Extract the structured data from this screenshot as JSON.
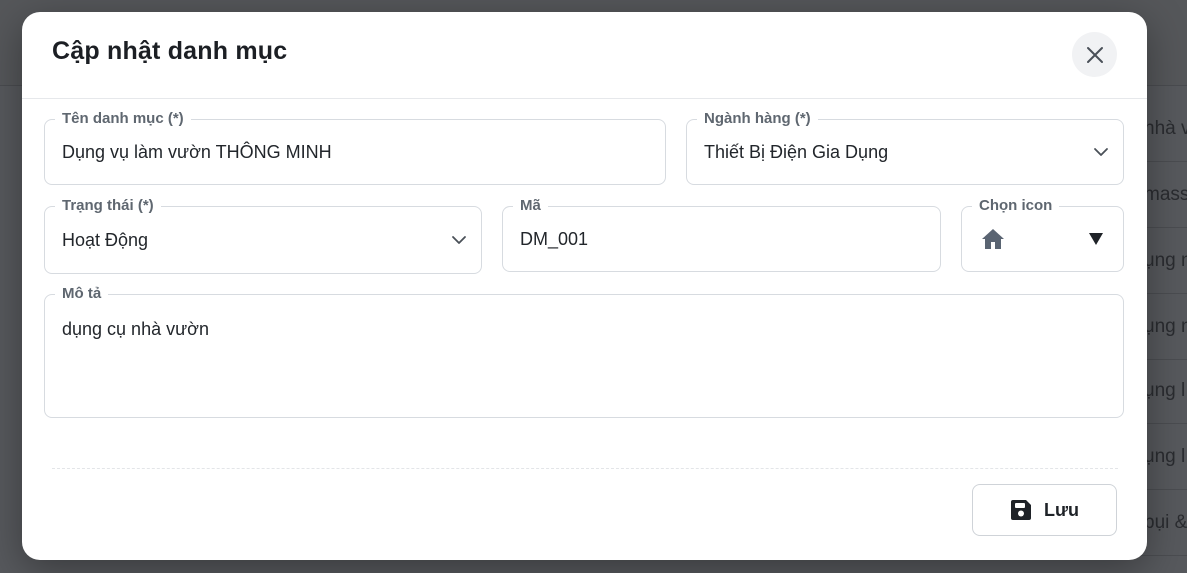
{
  "modal": {
    "title": "Cập nhật danh mục",
    "close_icon": "close-icon"
  },
  "form": {
    "category_name": {
      "label": "Tên danh mục (*)",
      "value": "Dụng vụ làm vườn THÔNG MINH"
    },
    "industry": {
      "label": "Ngành hàng (*)",
      "value": "Thiết Bị Điện Gia Dụng",
      "icon": "chevron-down-icon"
    },
    "status": {
      "label": "Trạng thái (*)",
      "value": "Hoạt Động",
      "icon": "chevron-down-icon"
    },
    "code": {
      "label": "Mã",
      "value": "DM_001"
    },
    "icon_picker": {
      "label": "Chọn icon",
      "selected_icon": "home-icon",
      "dropdown_icon": "caret-down-icon"
    },
    "description": {
      "label": "Mô tả",
      "value": "dụng cụ nhà vườn"
    }
  },
  "footer": {
    "save_label": "Lưu",
    "save_icon": "floppy-disk-icon"
  },
  "background_list": {
    "rows": [
      "nhà v",
      "mass",
      "ụng n",
      "ụng n",
      "ụng l",
      "ụng l",
      "bụi &"
    ]
  },
  "colors": {
    "overlay": "#5d5f63",
    "modal_bg": "#ffffff",
    "border": "#d7dbe0",
    "label": "#5f6770",
    "text": "#22262b"
  }
}
